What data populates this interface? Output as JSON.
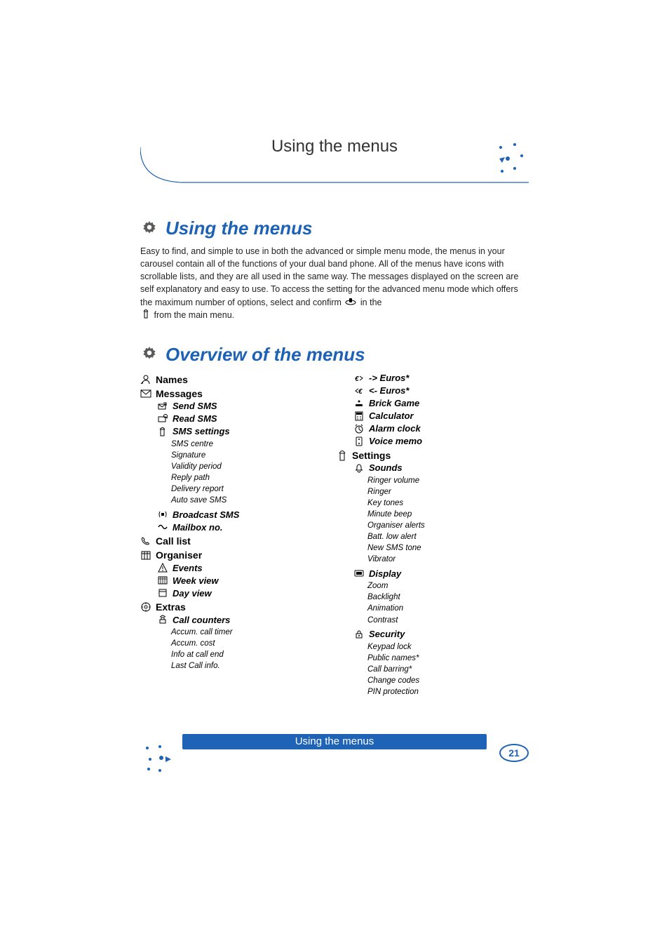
{
  "header": {
    "title": "Using the menus"
  },
  "section1": {
    "title": "Using the menus",
    "intro_1": "Easy to find, and simple to use in both the advanced or simple menu mode, the menus in your carousel contain all of the functions of your dual band phone.  All of the menus have icons with scrollable lists, and they are all used in the same way.  The messages displayed on the screen are self explanatory and easy to use.  To access the setting for the advanced menu mode which offers the maximum number of options, select and confirm ",
    "intro_2": " in the ",
    "intro_3": " from the main menu."
  },
  "section2": {
    "title": "Overview of the menus"
  },
  "left": {
    "names": "Names",
    "messages": "Messages",
    "send_sms": "Send SMS",
    "read_sms": "Read SMS",
    "sms_settings": "SMS settings",
    "sms_settings_items": [
      "SMS centre",
      "Signature",
      "Validity period",
      "Reply path",
      "Delivery report",
      "Auto save SMS"
    ],
    "broadcast_sms": "Broadcast SMS",
    "mailbox_no": "Mailbox no.",
    "call_list": "Call list",
    "organiser": "Organiser",
    "events": "Events",
    "week_view": "Week view",
    "day_view": "Day view",
    "extras": "Extras",
    "call_counters": "Call counters",
    "call_counters_items": [
      "Accum. call timer",
      "Accum. cost",
      "Info at call end",
      "Last Call info."
    ]
  },
  "right": {
    "to_euros": "-> Euros*",
    "from_euros": "<- Euros*",
    "brick_game": "Brick Game",
    "calculator": "Calculator",
    "alarm_clock": "Alarm clock",
    "voice_memo": "Voice memo",
    "settings": "Settings",
    "sounds": "Sounds",
    "sounds_items": [
      "Ringer volume",
      "Ringer",
      "Key tones",
      "Minute beep",
      "Organiser alerts",
      "Batt. low alert",
      "New SMS tone",
      "Vibrator"
    ],
    "display": "Display",
    "display_items": [
      "Zoom",
      "Backlight",
      "Animation",
      "Contrast"
    ],
    "security": "Security",
    "security_items": [
      "Keypad lock",
      "Public names*",
      "Call barring*",
      "Change codes",
      "PIN protection"
    ]
  },
  "footer": {
    "text": "Using the menus",
    "page": "21"
  }
}
